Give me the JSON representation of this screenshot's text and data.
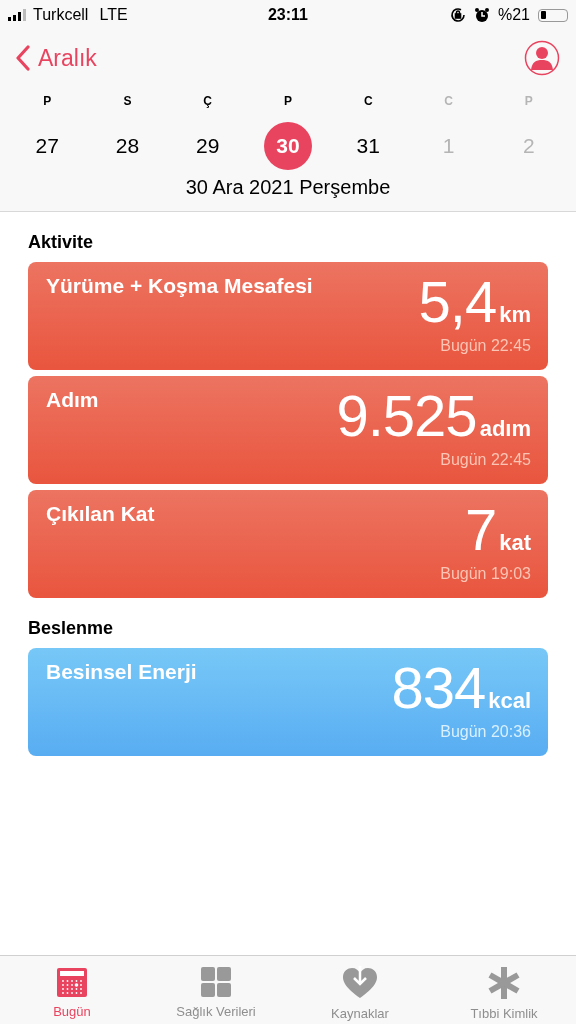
{
  "status_bar": {
    "carrier": "Turkcell",
    "network": "LTE",
    "time": "23:11",
    "battery": "%21"
  },
  "nav": {
    "back": "Aralık"
  },
  "week": [
    {
      "letter": "P",
      "day": "27",
      "selected": false,
      "disabled": false
    },
    {
      "letter": "S",
      "day": "28",
      "selected": false,
      "disabled": false
    },
    {
      "letter": "Ç",
      "day": "29",
      "selected": false,
      "disabled": false
    },
    {
      "letter": "P",
      "day": "30",
      "selected": true,
      "disabled": false
    },
    {
      "letter": "C",
      "day": "31",
      "selected": false,
      "disabled": false
    },
    {
      "letter": "C",
      "day": "1",
      "selected": false,
      "disabled": true
    },
    {
      "letter": "P",
      "day": "2",
      "selected": false,
      "disabled": true
    }
  ],
  "date_title": "30 Ara 2021 Perşembe",
  "sections": [
    {
      "title": "Aktivite",
      "cards": [
        {
          "kind": "activity",
          "title": "Yürüme + Koşma Mesafesi",
          "value": "5,4",
          "unit": "km",
          "time": "Bugün 22:45"
        },
        {
          "kind": "activity",
          "title": "Adım",
          "value": "9.525",
          "unit": "adım",
          "time": "Bugün 22:45"
        },
        {
          "kind": "activity",
          "title": "Çıkılan Kat",
          "value": "7",
          "unit": "kat",
          "time": "Bugün 19:03"
        }
      ]
    },
    {
      "title": "Beslenme",
      "cards": [
        {
          "kind": "nutrition",
          "title": "Besinsel Enerji",
          "value": "834",
          "unit": "kcal",
          "time": "Bugün 20:36"
        }
      ]
    }
  ],
  "tabs": [
    {
      "kind": "today",
      "label": "Bugün",
      "selected": true
    },
    {
      "kind": "data",
      "label": "Sağlık Verileri",
      "selected": false
    },
    {
      "kind": "sources",
      "label": "Kaynaklar",
      "selected": false
    },
    {
      "kind": "medical",
      "label": "Tıbbi Kimlik",
      "selected": false
    }
  ]
}
